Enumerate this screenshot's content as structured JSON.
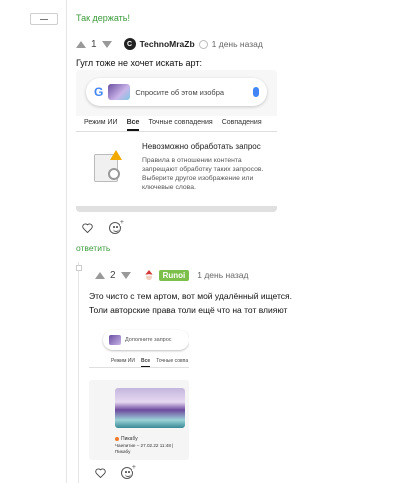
{
  "comment1": {
    "praise_text": "Так держать!",
    "votes": "1",
    "avatar_initial": "C",
    "author": "TechnoMraZb",
    "time": "1 день назад",
    "text": "Гугл тоже не хочет искать арт:",
    "reply_label": "ответить"
  },
  "google_screenshot": {
    "logo": "G",
    "placeholder": "Спросите об этом изобра",
    "tabs": [
      "Режим ИИ",
      "Все",
      "Точные совпадения",
      "Совпадения"
    ],
    "active_tab": "Все",
    "error_title": "Невозможно обработать запрос",
    "error_body": "Правила в отношении контента запрещают обработку таких запросов. Выберите другое изображение или ключевые слова."
  },
  "comment2": {
    "votes": "2",
    "author": "Runoi",
    "time": "1 день назад",
    "text_lines": [
      "Это чисто с тем артом, вот мой удалённый ищется.",
      "Толи авторские права толи ещё что на тот влияют"
    ]
  },
  "google_screenshot2": {
    "placeholder": "Дополните запрос",
    "tabs": [
      "Режим ИИ",
      "Все",
      "Точные совпа"
    ],
    "active_tab": "Все",
    "source": "Пикабу",
    "caption": "Чаепитие – 27.02.22 11:48 | Пикабу"
  },
  "colors": {
    "green_accent": "#3c9a3c",
    "runoi_badge": "#7cc04b",
    "google_blue": "#4285f4",
    "warning": "#f2a900"
  }
}
